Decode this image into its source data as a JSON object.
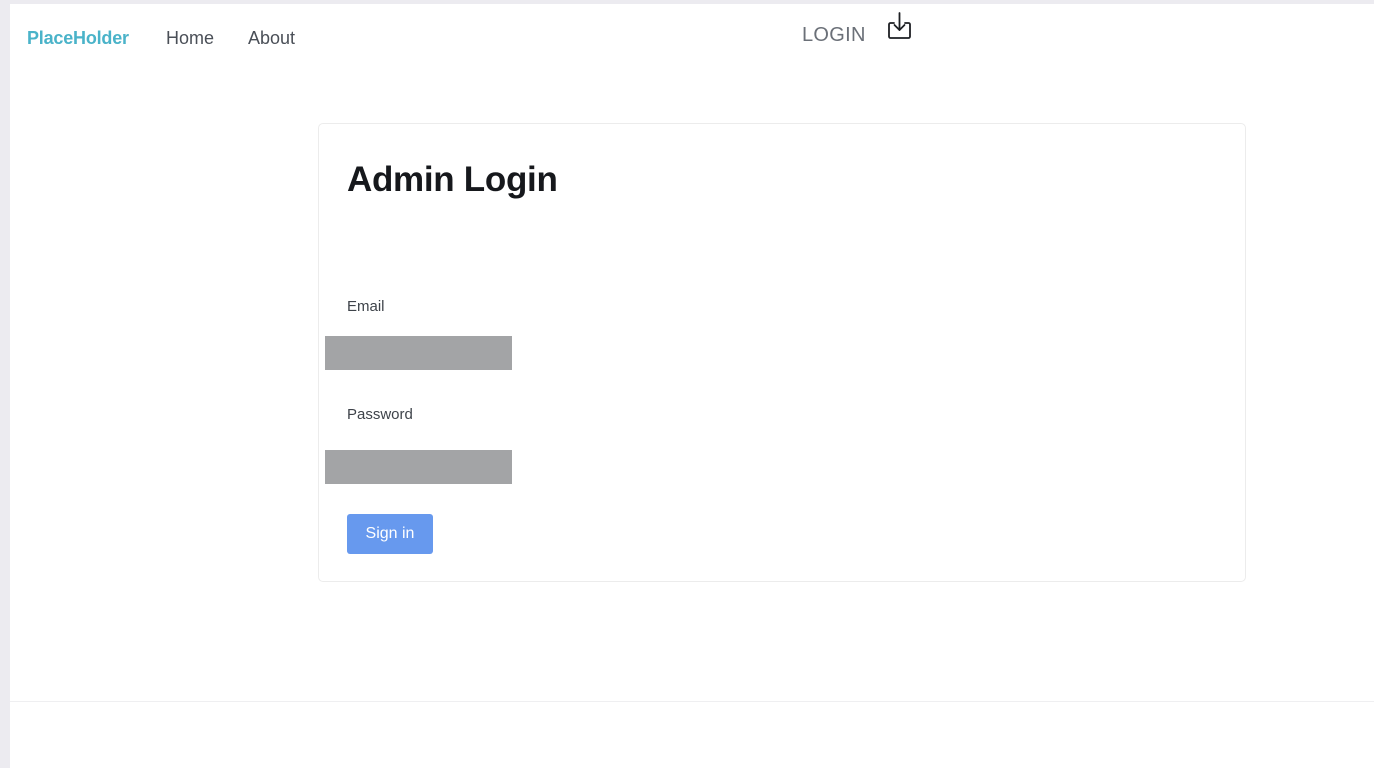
{
  "header": {
    "brand": "PlaceHolder",
    "nav": [
      {
        "label": "Home"
      },
      {
        "label": "About"
      }
    ],
    "login_label": "LOGIN",
    "login_icon": "login-tray-icon"
  },
  "card": {
    "title": "Admin Login",
    "email_label": "Email",
    "email_value": "",
    "password_label": "Password",
    "password_value": "",
    "signin_label": "Sign in"
  },
  "colors": {
    "brand": "#4ab3c9",
    "button": "#6799ee",
    "input_fill": "#a3a4a6",
    "page_bg": "#ecebf0"
  }
}
